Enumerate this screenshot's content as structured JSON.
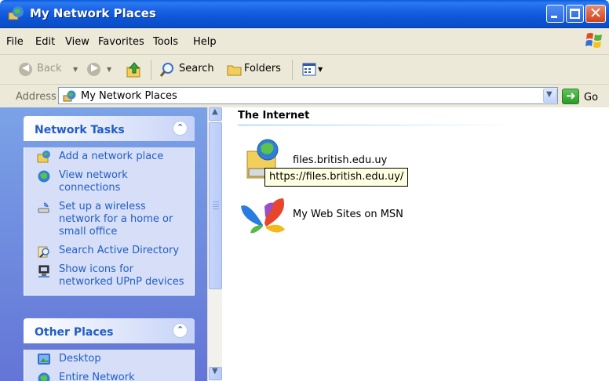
{
  "window": {
    "title": "My Network Places"
  },
  "menu": {
    "items": [
      "File",
      "Edit",
      "View",
      "Favorites",
      "Tools",
      "Help"
    ]
  },
  "toolbar": {
    "back_label": "Back",
    "search_label": "Search",
    "folders_label": "Folders"
  },
  "address": {
    "label": "Address",
    "value": "My Network Places",
    "go_label": "Go"
  },
  "network_tasks": {
    "title": "Network Tasks",
    "items": [
      {
        "label": "Add a network place",
        "icon": "add-network-place-icon"
      },
      {
        "label": "View network connections",
        "icon": "network-connections-icon"
      },
      {
        "label": "Set up a wireless network for a home or small office",
        "icon": "wireless-network-icon"
      },
      {
        "label": "Search Active Directory",
        "icon": "search-directory-icon"
      },
      {
        "label": "Show icons for networked UPnP devices",
        "icon": "upnp-devices-icon"
      }
    ]
  },
  "other_places": {
    "title": "Other Places",
    "items": [
      {
        "label": "Desktop",
        "icon": "desktop-icon"
      },
      {
        "label": "Entire Network",
        "icon": "entire-network-icon"
      }
    ]
  },
  "content": {
    "group_title": "The Internet",
    "items": [
      {
        "label": "files.british.edu.uy",
        "icon": "web-folder-icon"
      },
      {
        "label": "My Web Sites on MSN",
        "icon": "msn-butterfly-icon"
      }
    ],
    "tooltip": "https://files.british.edu.uy/"
  },
  "colors": {
    "titlebar": "#0b4fc8",
    "task_link": "#215dc6",
    "panel_bg": "#7ba2e7",
    "tooltip_bg": "#ffffe1"
  }
}
